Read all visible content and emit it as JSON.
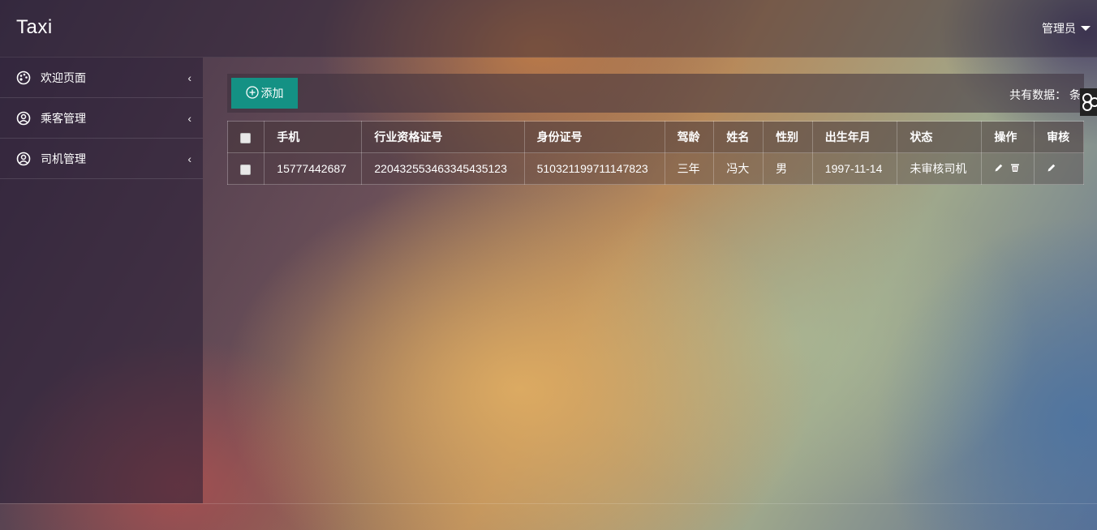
{
  "header": {
    "logo": "Taxi",
    "user_menu": "管理员"
  },
  "sidebar": {
    "items": [
      {
        "label": "欢迎页面",
        "icon": "palette-icon"
      },
      {
        "label": "乘客管理",
        "icon": "user-circle-icon"
      },
      {
        "label": "司机管理",
        "icon": "user-circle-icon"
      }
    ]
  },
  "toolbar": {
    "add_label": "添加",
    "count_label": "共有数据： 条"
  },
  "table": {
    "headers": [
      "手机",
      "行业资格证号",
      "身份证号",
      "驾龄",
      "姓名",
      "性别",
      "出生年月",
      "状态",
      "操作",
      "审核"
    ],
    "rows": [
      [
        "15777442687",
        "220432553463345435123",
        "510321199711147823",
        "三年",
        "冯大",
        "男",
        "1997-11-14",
        "未审核司机"
      ]
    ]
  },
  "colors": {
    "add_button": "#149184"
  }
}
